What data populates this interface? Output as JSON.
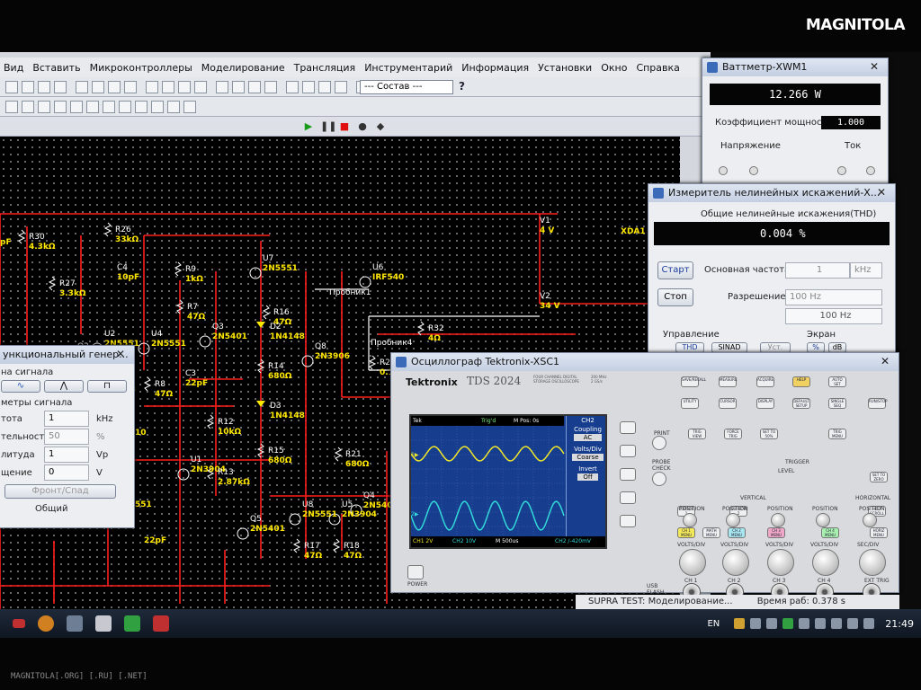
{
  "branding": {
    "logo_text": "MAGNITOLA",
    "watermark": "MAGNITOLA[.ORG] [.RU] [.NET]"
  },
  "menu": [
    "Вид",
    "Вставить",
    "Микроконтроллеры",
    "Моделирование",
    "Трансляция",
    "Инструментарий",
    "Информация",
    "Установки",
    "Окно",
    "Справка"
  ],
  "toolbar": {
    "layer_combo": "--- Состав ---",
    "help": "?"
  },
  "schematic": {
    "components": [
      {
        "id": "R26",
        "val": "33kΩ"
      },
      {
        "id": "R30",
        "val": "4.3kΩ"
      },
      {
        "id": "C4",
        "val": "10pF"
      },
      {
        "id": "R27",
        "val": "3.3kΩ"
      },
      {
        "id": "R9",
        "val": "1kΩ"
      },
      {
        "id": "R7",
        "val": "47Ω"
      },
      {
        "id": "U7",
        "val": "2N5551"
      },
      {
        "id": "U6",
        "val": "IRF540"
      },
      {
        "id": "V1",
        "val": "4 V"
      },
      {
        "id": "V2",
        "val": "34 V"
      },
      {
        "id": "R16",
        "val": "47Ω"
      },
      {
        "id": "D2",
        "val": "1N4148"
      },
      {
        "id": "Q2",
        "val": "BC556AP"
      },
      {
        "id": "U2",
        "val": "2N5551"
      },
      {
        "id": "U4",
        "val": "2N5551"
      },
      {
        "id": "Q3",
        "val": "2N5401"
      },
      {
        "id": "Q8",
        "val": "2N3906"
      },
      {
        "id": "R32",
        "val": "4Ω"
      },
      {
        "id": "C5",
        "val": "10µF"
      },
      {
        "id": "R8",
        "val": "47Ω"
      },
      {
        "id": "C3",
        "val": "22pF"
      },
      {
        "id": "R14",
        "val": "680Ω"
      },
      {
        "id": "R24",
        "val": "0.1Ω"
      },
      {
        "id": "R25",
        "val": "0.1Ω"
      },
      {
        "id": "R31",
        "val": "4.7Ω"
      },
      {
        "id": "D3",
        "val": "1N4148"
      },
      {
        "id": "R12",
        "val": "10kΩ"
      },
      {
        "id": "U1",
        "val": "2N3904"
      },
      {
        "id": "R15",
        "val": "680Ω"
      },
      {
        "id": "R21",
        "val": "680Ω"
      },
      {
        "id": "R13",
        "val": "2.87kΩ"
      },
      {
        "id": "U8",
        "val": "2N5551"
      },
      {
        "id": "U5",
        "val": "2N3904"
      },
      {
        "id": "Q4",
        "val": "2N5401"
      },
      {
        "id": "Q5",
        "val": "2N5401"
      },
      {
        "id": "R17",
        "val": "47Ω"
      },
      {
        "id": "R18",
        "val": "47Ω"
      }
    ],
    "extra_labels": [
      "Пробник1",
      "Пробник4",
      "Пробник3",
      "U10",
      "XDA1",
      "22pF",
      "10",
      "R1",
      "R3",
      "pF",
      "551"
    ]
  },
  "wattmeter": {
    "title": "Ваттметр-XWM1",
    "reading": "12.266 W",
    "pf_label": "Коэффициент мощности:",
    "pf_value": "1.000",
    "voltage_label": "Напряжение",
    "current_label": "Ток"
  },
  "distortion": {
    "title": "Измеритель нелинейных искажений-X...",
    "thd_label": "Общие нелинейные искажения(THD)",
    "thd_value": "0.004 %",
    "start": "Старт",
    "stop": "Стоп",
    "fund_label": "Основная частота:",
    "fund_value": "1",
    "fund_unit": "kHz",
    "res_label": "Разрешение:",
    "res_value": "100 Hz",
    "res_extra": "100 Hz",
    "control_label": "Управление",
    "screen_label": "Экран",
    "thd_btn": "THD",
    "sinad_btn": "SINAD",
    "ust_btn": "Уст.",
    "pct_btn": "%",
    "db_btn": "dB"
  },
  "funcgen": {
    "title": "ункциональный генер...",
    "signal_label": "на сигнала",
    "params_label": "метры сигнала",
    "freq_label": "тота",
    "freq_val": "1",
    "freq_unit": "kHz",
    "duty_label": "тельность",
    "duty_val": "50",
    "duty_unit": "%",
    "amp_label": "литуда",
    "amp_val": "1",
    "amp_unit": "Vp",
    "off_label": "щение",
    "off_val": "0",
    "off_unit": "V",
    "rise_btn": "Фронт/Спад",
    "common": "Общий"
  },
  "scope": {
    "title": "Осциллограф Tektronix-XSC1",
    "brand": "Tektronix",
    "model": "TDS 2024",
    "model_sub": "FOUR CHANNEL DIGITAL STORAGE OSCILLOSCOPE",
    "bw": "200 MHz 2 GS/s",
    "top_status": [
      "Tek",
      "Trig'd",
      "M Pos: 0s"
    ],
    "menu_title": "CH2",
    "menu_items": [
      "Coupling",
      "AC",
      "Volts/Div",
      "Coarse",
      "Invert",
      "Off"
    ],
    "bottom_status": [
      "CH1 2V",
      "CH2 10V",
      "M 500us",
      "CH2 /-420mV"
    ],
    "power": "POWER",
    "ch_labels": [
      "CH 1",
      "CH 2",
      "CH 3",
      "CH 4",
      "EXT TRIG"
    ],
    "volts_div": [
      "VOLTS/DIV",
      "VOLTS/DIV",
      "VOLTS/DIV",
      "VOLTS/DIV",
      "SEC/DIV"
    ],
    "sections": [
      "VERTICAL",
      "HORIZONTAL",
      "TRIGGER",
      "LEVEL"
    ],
    "position": "POSITION",
    "print": "PRINT",
    "probe_check": "PROBE CHECK",
    "menu_btns": [
      "SAVE/RECALL",
      "MEASURE",
      "ACQUIRE",
      "HELP",
      "UTILITY",
      "CURSOR",
      "DISPLAY",
      "DEFAULT SETUP",
      "AUTO SET",
      "SINGLE SEQ",
      "RUN/STOP",
      "TRIG VIEW",
      "FORCE TRIG",
      "SET TO 50%",
      "TRIG MENU",
      "CH 1 MENU",
      "MATH MENU",
      "CH 2 MENU",
      "CH 3 MENU",
      "CH 4 MENU",
      "HORIZ MENU",
      "SET TO ZERO",
      "CURSOR 1",
      "CURSOR 2",
      "HELP SCROLL",
      "USB FLASH DRIVE"
    ],
    "ch1_level": 0.28,
    "ch2_level": 0.74
  },
  "status": {
    "text": "SUPRA TEST: Моделирование...",
    "time": "Время раб: 0.378 s"
  },
  "taskbar": {
    "lang": "EN",
    "clock": "21:49"
  },
  "colors": {
    "wire": "#ff1e1e",
    "label": "#ffe800",
    "ch1": "#f2e82a",
    "ch2": "#33d8d8",
    "screen": "#163d8e"
  }
}
